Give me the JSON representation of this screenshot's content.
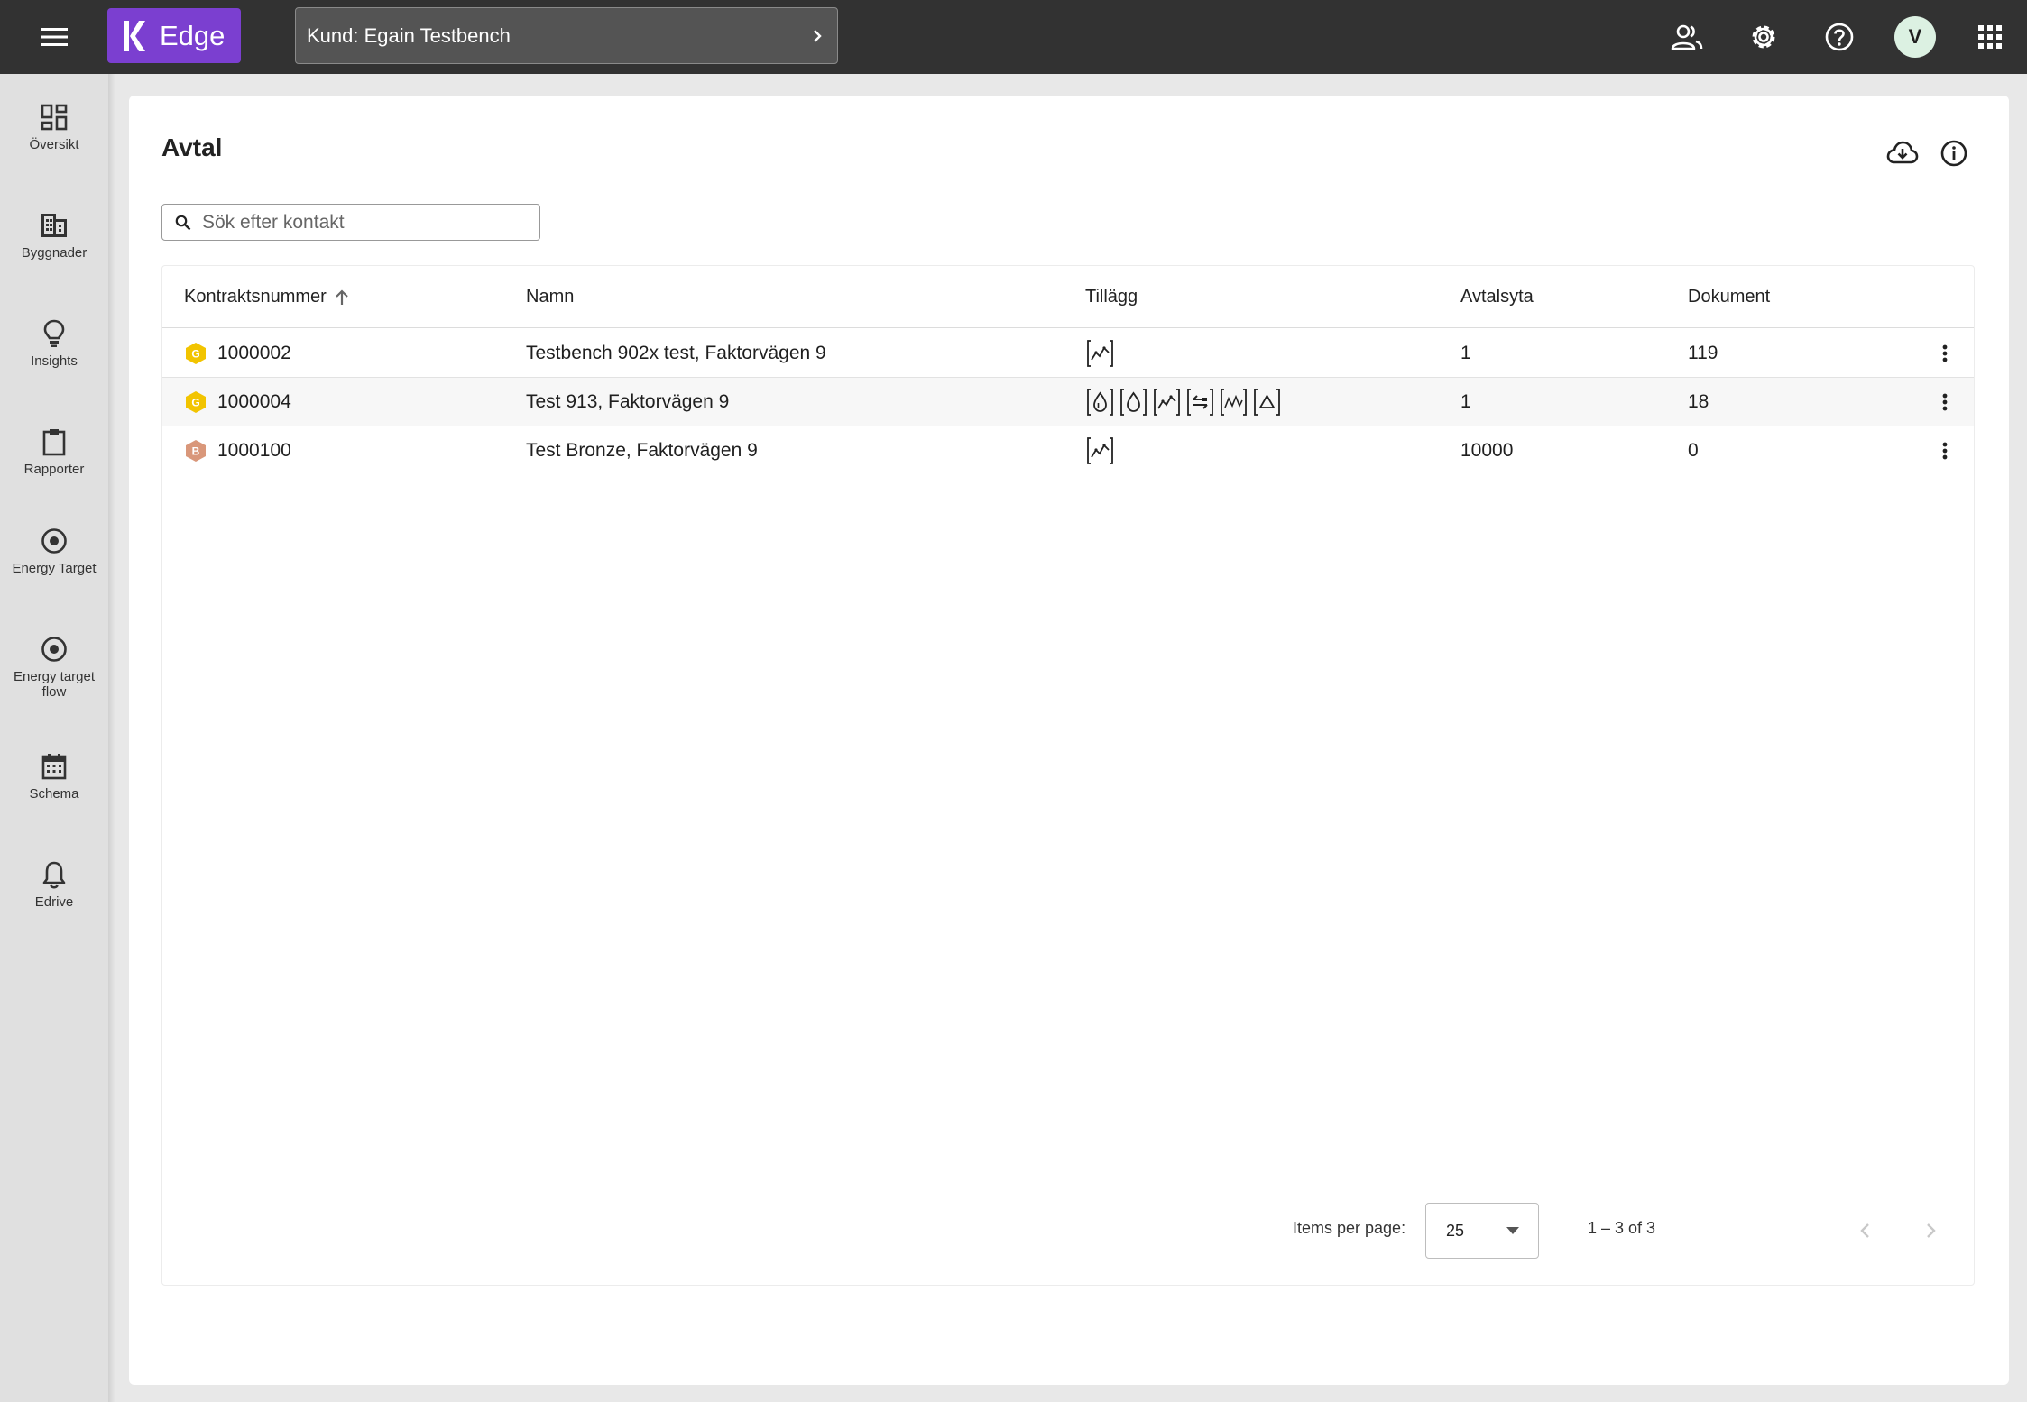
{
  "app": {
    "logo_text": "Edge",
    "brand_color": "#7b3fd0",
    "customer_label": "Kund: Egain Testbench",
    "avatar_initial": "V"
  },
  "topbar_icons": [
    "menu-icon",
    "users-icon",
    "gear-icon",
    "help-icon",
    "apps-grid-icon"
  ],
  "sidebar": {
    "items": [
      {
        "label": "Översikt",
        "icon": "dashboard-icon"
      },
      {
        "label": "Byggnader",
        "icon": "building-icon"
      },
      {
        "label": "Insights",
        "icon": "lightbulb-icon"
      },
      {
        "label": "Rapporter",
        "icon": "clipboard-icon"
      },
      {
        "label": "Energy Target",
        "icon": "target-icon"
      },
      {
        "label": "Energy target flow",
        "icon": "target-icon"
      },
      {
        "label": "Schema",
        "icon": "calendar-icon"
      },
      {
        "label": "Edrive",
        "icon": "bell-icon"
      }
    ]
  },
  "page": {
    "title": "Avtal",
    "search_placeholder": "Sök efter kontakt"
  },
  "table": {
    "columns": [
      "Kontraktsnummer",
      "Namn",
      "Tillägg",
      "Avtalsyta",
      "Dokument"
    ],
    "sort_column": "Kontraktsnummer",
    "sort_direction": "ascending",
    "rows": [
      {
        "badge": "G",
        "badge_color": "#f2c400",
        "contract": "1000002",
        "name": "Testbench 902x test, Faktorvägen 9",
        "addons": [
          "chart-line-icon"
        ],
        "area": "1",
        "documents": "119"
      },
      {
        "badge": "G",
        "badge_color": "#f2c400",
        "contract": "1000004",
        "name": "Test 913, Faktorvägen 9",
        "addons": [
          "drop-icon",
          "drop-outline-icon",
          "chart-line-icon",
          "transfer-icon",
          "wave-icon",
          "triangle-icon"
        ],
        "area": "1",
        "documents": "18"
      },
      {
        "badge": "B",
        "badge_color": "#d9977a",
        "contract": "1000100",
        "name": "Test Bronze, Faktorvägen 9",
        "addons": [
          "chart-line-icon"
        ],
        "area": "10000",
        "documents": "0"
      }
    ]
  },
  "paginator": {
    "items_per_page_label": "Items per page:",
    "items_per_page": "25",
    "range_label": "1 – 3 of 3"
  }
}
